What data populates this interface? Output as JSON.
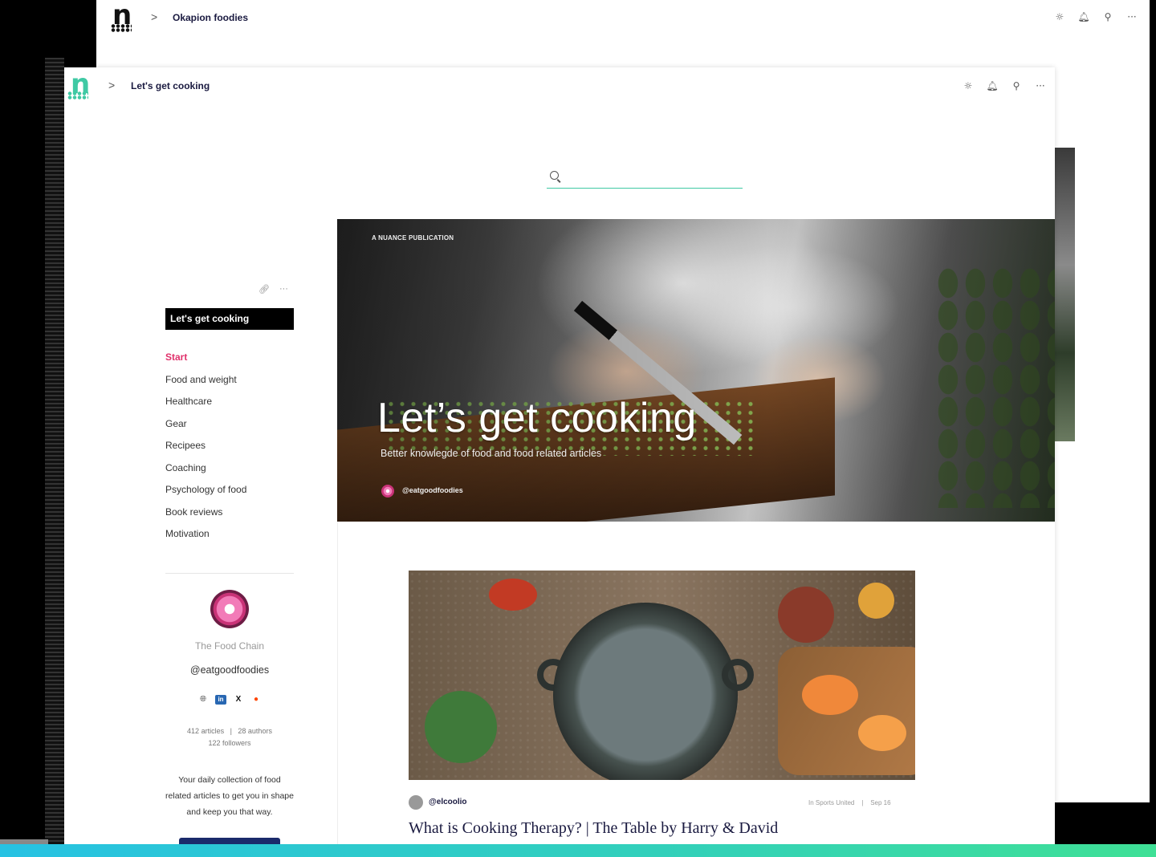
{
  "back_window": {
    "breadcrumb_chevron": ">",
    "title": "Okapion foodies",
    "icons": [
      "settings-icon",
      "bell-icon",
      "user-icon",
      "more-icon"
    ]
  },
  "front_window": {
    "breadcrumb_chevron": ">",
    "title": "Let's get cooking",
    "icons": [
      "settings-icon",
      "bell-icon",
      "user-icon",
      "more-icon"
    ],
    "icon_glyphs": [
      "☼",
      "🔔︎",
      "⚲",
      "···"
    ]
  },
  "search": {
    "placeholder": "",
    "value": ""
  },
  "sidebar": {
    "tools": [
      "🔗︎",
      "···"
    ],
    "publication_title": "Let's get cooking",
    "nav": [
      {
        "label": "Start",
        "active": true
      },
      {
        "label": "Food and weight"
      },
      {
        "label": "Healthcare"
      },
      {
        "label": "Gear"
      },
      {
        "label": "Recipees"
      },
      {
        "label": "Coaching"
      },
      {
        "label": "Psychology of food"
      },
      {
        "label": "Book reviews"
      },
      {
        "label": "Motivation"
      }
    ],
    "pub_name": "The Food Chain",
    "pub_handle": "@eatgoodfoodies",
    "social": [
      "🌐︎",
      "in",
      "X",
      "●"
    ],
    "stats_line1": "412 articles   |   28 authors",
    "stats_line2": "122 followers",
    "about": "Your daily collection of food related articles to get you in shape and keep you that way."
  },
  "hero": {
    "kicker": "A NUANCE PUBLICATION",
    "title": "Let’s get cooking",
    "subtitle": "Better knowlegde of food and food related articles",
    "author": "@eatgoodfoodies"
  },
  "article": {
    "author": "@elcoolio",
    "meta": "In Sports United    |    Sep 16",
    "title": "What is Cooking Therapy? | The Table by Harry & David"
  },
  "colors": {
    "accent_teal": "#3fc9a4",
    "active_nav": "#e0316b",
    "dark_navy": "#1a1a40",
    "bottom_gradient_start": "#27c2e3",
    "bottom_gradient_end": "#3fe096"
  }
}
